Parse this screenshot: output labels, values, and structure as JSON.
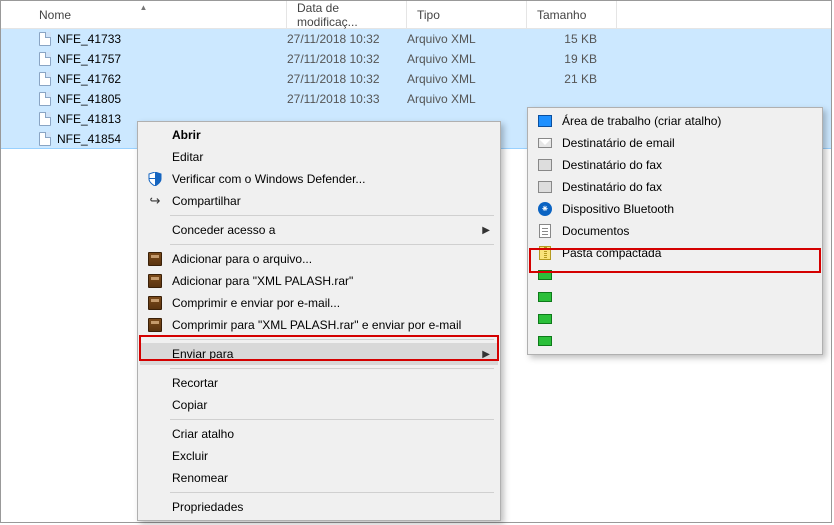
{
  "columns": {
    "name": "Nome",
    "date": "Data de modificaç...",
    "type": "Tipo",
    "size": "Tamanho"
  },
  "files": [
    {
      "name": "NFE_41733",
      "date": "27/11/2018 10:32",
      "type": "Arquivo XML",
      "size": "15 KB"
    },
    {
      "name": "NFE_41757",
      "date": "27/11/2018 10:32",
      "type": "Arquivo XML",
      "size": "19 KB"
    },
    {
      "name": "NFE_41762",
      "date": "27/11/2018 10:32",
      "type": "Arquivo XML",
      "size": "21 KB"
    },
    {
      "name": "NFE_41805",
      "date": "27/11/2018 10:33",
      "type": "Arquivo XML",
      "size": ""
    },
    {
      "name": "NFE_41813",
      "date": "",
      "type": "",
      "size": ""
    },
    {
      "name": "NFE_41854",
      "date": "",
      "type": "",
      "size": ""
    }
  ],
  "menu": {
    "open": "Abrir",
    "edit": "Editar",
    "defender": "Verificar com o Windows Defender...",
    "share": "Compartilhar",
    "grant_access": "Conceder acesso a",
    "add_archive": "Adicionar para o arquivo...",
    "add_rar": "Adicionar para \"XML PALASH.rar\"",
    "compress_email": "Comprimir e enviar por e-mail...",
    "compress_rar_email": "Comprimir para \"XML PALASH.rar\" e enviar por e-mail",
    "send_to": "Enviar para",
    "cut": "Recortar",
    "copy": "Copiar",
    "create_shortcut": "Criar atalho",
    "delete": "Excluir",
    "rename": "Renomear",
    "properties": "Propriedades"
  },
  "submenu": {
    "desktop": "Área de trabalho (criar atalho)",
    "email": "Destinatário de email",
    "fax1": "Destinatário do fax",
    "fax2": "Destinatário do fax",
    "bluetooth": "Dispositivo Bluetooth",
    "documents": "Documentos",
    "zip": "Pasta compactada",
    "blank1": "",
    "blank2": "",
    "blank3": "",
    "blank4": ""
  }
}
